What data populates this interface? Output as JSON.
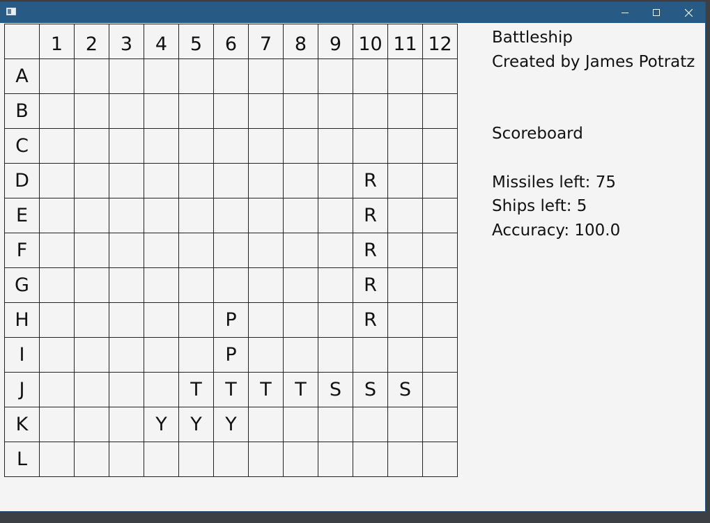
{
  "window": {
    "title": ""
  },
  "board": {
    "columns": [
      "1",
      "2",
      "3",
      "4",
      "5",
      "6",
      "7",
      "8",
      "9",
      "10",
      "11",
      "12"
    ],
    "rows": [
      "A",
      "B",
      "C",
      "D",
      "E",
      "F",
      "G",
      "H",
      "I",
      "J",
      "K",
      "L"
    ],
    "cells": [
      [
        "",
        "",
        "",
        "",
        "",
        "",
        "",
        "",
        "",
        "",
        "",
        ""
      ],
      [
        "",
        "",
        "",
        "",
        "",
        "",
        "",
        "",
        "",
        "",
        "",
        ""
      ],
      [
        "",
        "",
        "",
        "",
        "",
        "",
        "",
        "",
        "",
        "",
        "",
        ""
      ],
      [
        "",
        "",
        "",
        "",
        "",
        "",
        "",
        "",
        "",
        "R",
        "",
        ""
      ],
      [
        "",
        "",
        "",
        "",
        "",
        "",
        "",
        "",
        "",
        "R",
        "",
        ""
      ],
      [
        "",
        "",
        "",
        "",
        "",
        "",
        "",
        "",
        "",
        "R",
        "",
        ""
      ],
      [
        "",
        "",
        "",
        "",
        "",
        "",
        "",
        "",
        "",
        "R",
        "",
        ""
      ],
      [
        "",
        "",
        "",
        "",
        "",
        "P",
        "",
        "",
        "",
        "R",
        "",
        ""
      ],
      [
        "",
        "",
        "",
        "",
        "",
        "P",
        "",
        "",
        "",
        "",
        "",
        ""
      ],
      [
        "",
        "",
        "",
        "",
        "T",
        "T",
        "T",
        "T",
        "S",
        "S",
        "S",
        ""
      ],
      [
        "",
        "",
        "",
        "Y",
        "Y",
        "Y",
        "",
        "",
        "",
        "",
        "",
        ""
      ],
      [
        "",
        "",
        "",
        "",
        "",
        "",
        "",
        "",
        "",
        "",
        "",
        ""
      ]
    ]
  },
  "info": {
    "title": "Battleship",
    "author": "Created by James Potratz",
    "scoreboard_heading": "Scoreboard",
    "missiles_left": "Missiles left: 75",
    "ships_left": "Ships left: 5",
    "accuracy": "Accuracy: 100.0"
  },
  "icons": {
    "app": "app-window-icon",
    "minimize": "minimize-icon",
    "maximize": "maximize-icon",
    "close": "close-icon"
  },
  "colors": {
    "titlebar": "#275b86",
    "background": "#f4f4f4",
    "gridline": "#222222"
  }
}
